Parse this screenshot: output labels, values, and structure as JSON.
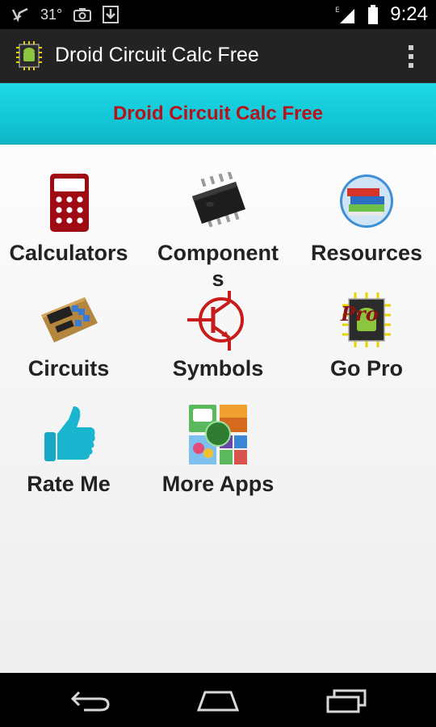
{
  "status_bar": {
    "temperature": "31°",
    "time": "9:24",
    "network": "E"
  },
  "action_bar": {
    "title": "Droid Circuit Calc Free",
    "menu_icon": "overflow-menu-icon"
  },
  "banner": {
    "title": "Droid Circuit Calc Free"
  },
  "tiles": [
    {
      "label": "Calculators",
      "icon": "calculator-icon"
    },
    {
      "label": "Component\ns",
      "icon": "chip-icon"
    },
    {
      "label": "Resources",
      "icon": "books-icon"
    },
    {
      "label": "Circuits",
      "icon": "circuit-board-icon"
    },
    {
      "label": "Symbols",
      "icon": "transistor-symbol-icon"
    },
    {
      "label": "Go Pro",
      "icon": "go-pro-icon"
    },
    {
      "label": "Rate Me",
      "icon": "thumbs-up-icon"
    },
    {
      "label": "More Apps",
      "icon": "more-apps-icon"
    }
  ],
  "colors": {
    "banner": "#13cbdb",
    "banner_text": "#b5121b",
    "action_bar": "#232323"
  },
  "nav_bar": {
    "buttons": [
      "back-icon",
      "home-icon",
      "recent-apps-icon"
    ]
  }
}
